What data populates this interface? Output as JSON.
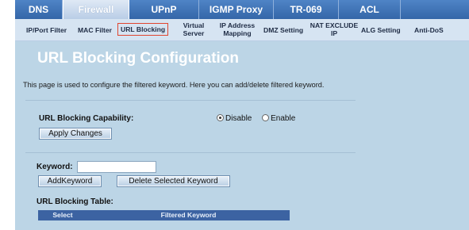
{
  "top_nav": {
    "tabs": [
      {
        "label": "DNS"
      },
      {
        "label": "Firewall",
        "active": true
      },
      {
        "label": "UPnP"
      },
      {
        "label": "IGMP Proxy"
      },
      {
        "label": "TR-069"
      },
      {
        "label": "ACL"
      }
    ]
  },
  "sub_nav": {
    "tabs": [
      {
        "label": "IP/Port Filter"
      },
      {
        "label": "MAC Filter"
      },
      {
        "label": "URL Blocking",
        "active": true
      },
      {
        "label_line1": "Virtual",
        "label_line2": "Server"
      },
      {
        "label_line1": "IP Address",
        "label_line2": "Mapping"
      },
      {
        "label": "DMZ Setting"
      },
      {
        "label_line1": "NAT EXCLUDE",
        "label_line2": "IP"
      },
      {
        "label": "ALG Setting"
      },
      {
        "label": "Anti-DoS"
      }
    ]
  },
  "page": {
    "title": "URL Blocking Configuration",
    "description": "This page is used to configure the filtered keyword. Here you can add/delete filtered keyword."
  },
  "capability": {
    "label": "URL Blocking Capability:",
    "options": [
      {
        "label": "Disable",
        "checked": true
      },
      {
        "label": "Enable",
        "checked": false
      }
    ],
    "apply_button": "Apply Changes"
  },
  "keyword": {
    "label": "Keyword:",
    "value": "",
    "add_button": "AddKeyword",
    "delete_button": "Delete Selected Keyword"
  },
  "table": {
    "title": "URL Blocking Table:",
    "columns": [
      "Select",
      "Filtered Keyword"
    ]
  },
  "colors": {
    "top_nav": "#3a6db0",
    "sub_nav": "#d6e4f2",
    "panel": "#bcd5e6",
    "table_header": "#3c63a2",
    "active_outline": "#e0452f"
  }
}
